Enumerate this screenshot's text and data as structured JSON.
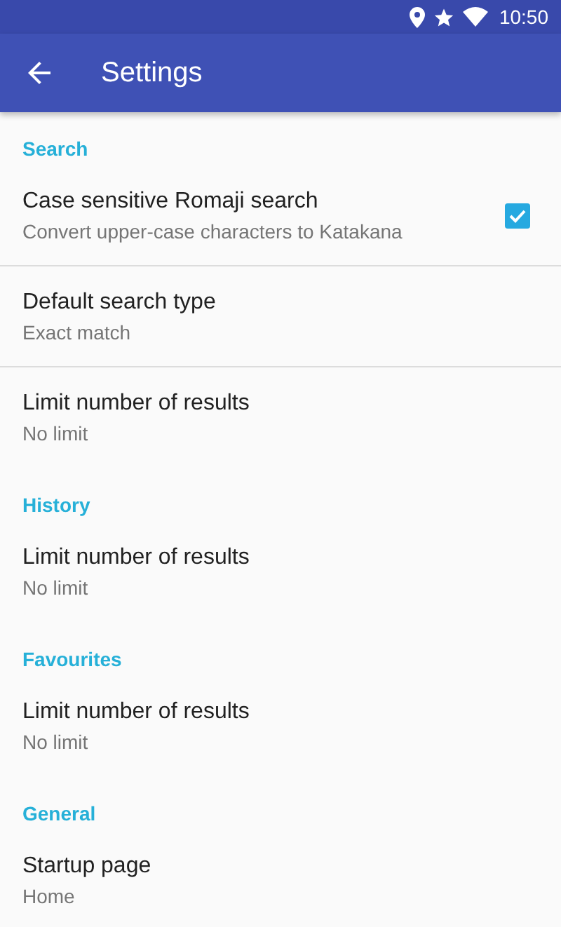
{
  "status_bar": {
    "time": "10:50"
  },
  "app_bar": {
    "title": "Settings"
  },
  "sections": [
    {
      "title": "Search",
      "items": [
        {
          "kind": "checkbox",
          "title": "Case sensitive Romaji search",
          "summary": "Convert upper-case characters to Katakana",
          "checked": true
        },
        {
          "kind": "plain",
          "title": "Default search type",
          "summary": "Exact match"
        },
        {
          "kind": "plain",
          "title": "Limit number of results",
          "summary": "No limit"
        }
      ]
    },
    {
      "title": "History",
      "items": [
        {
          "kind": "plain",
          "title": "Limit number of results",
          "summary": "No limit"
        }
      ]
    },
    {
      "title": "Favourites",
      "items": [
        {
          "kind": "plain",
          "title": "Limit number of results",
          "summary": "No limit"
        }
      ]
    },
    {
      "title": "General",
      "items": [
        {
          "kind": "plain",
          "title": "Startup page",
          "summary": "Home"
        }
      ]
    }
  ]
}
